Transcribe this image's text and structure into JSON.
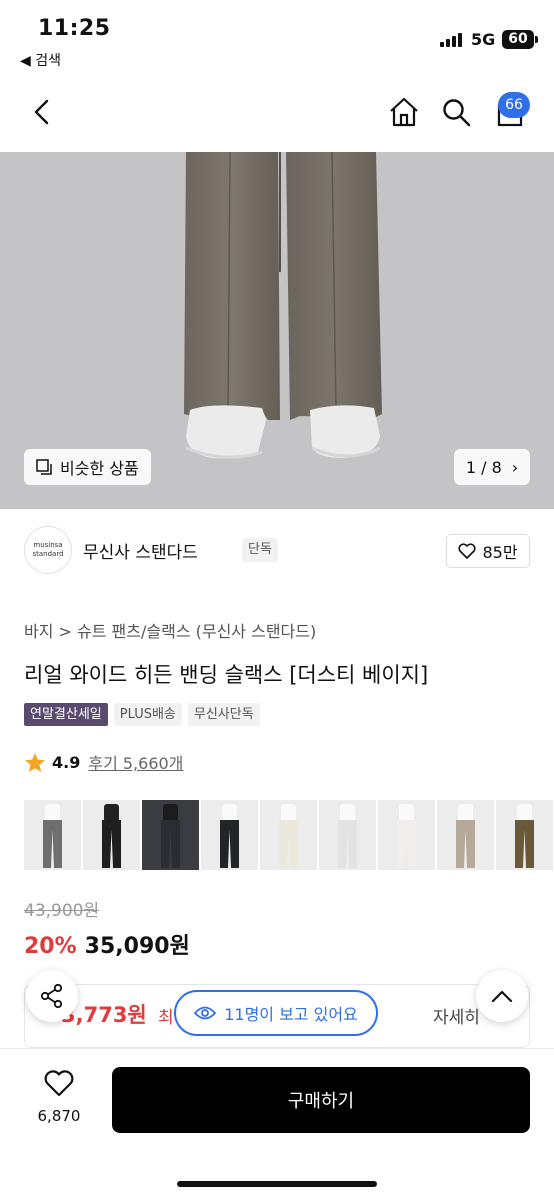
{
  "status_bar": {
    "time": "11:25",
    "back_app": "◀ 검색",
    "network": "5G",
    "battery": "60"
  },
  "nav": {
    "cart_count": "66",
    "icons": [
      "back-icon",
      "home-icon",
      "search-icon",
      "cart-icon"
    ]
  },
  "hero": {
    "similar_label": "비슷한 상품",
    "pager": "1 / 8"
  },
  "brand": {
    "logo_line1": "musinsa",
    "logo_line2": "standard",
    "name": "무신사 스탠다드",
    "tag": "단독",
    "likes": "85만"
  },
  "product": {
    "breadcrumb": "바지 > 슈트 팬츠/슬랙스 (무신사 스탠다드)",
    "title": "리얼 와이드 히든 밴딩 슬랙스 [더스티 베이지]",
    "badges": [
      {
        "label": "연말결산세일",
        "color": "#5a4b6e"
      },
      {
        "label": "PLUS배송",
        "color": "#f2f2f2"
      },
      {
        "label": "무신사단독",
        "color": "#f2f2f2"
      }
    ],
    "rating": "4.9",
    "reviews": "후기 5,660개",
    "color_options": [
      "#6e6e6e",
      "#1f1f1f",
      "#2b2d33",
      "#222428",
      "#ece8dc",
      "#e3e3e3",
      "#efeeea",
      "#b5aa99",
      "#6a5a3a"
    ]
  },
  "price": {
    "original": "43,900원",
    "discount": "20%",
    "sale": "35,090원",
    "benefit_price": "3,773원",
    "benefit_label": "최",
    "benefit_detail": "자세히"
  },
  "floating": {
    "viewers": "11명이 보고 있어요"
  },
  "bottom": {
    "wish_count": "6,870",
    "buy_label": "구매하기"
  }
}
